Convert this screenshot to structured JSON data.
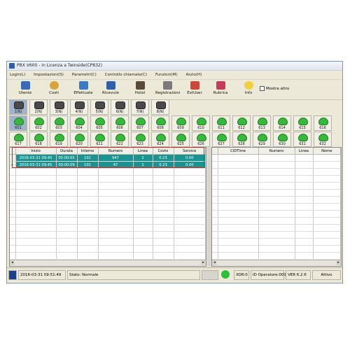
{
  "window": {
    "title": "PBX V600 - in Licenza a Twinside(CP832)"
  },
  "menu": [
    "Login(L)",
    "Impostazioni(S)",
    "Parametri(C)",
    "Controllo chiamate(C)",
    "Funzioni(M)",
    "Aiuto(H)"
  ],
  "toolbar": {
    "buttons": [
      {
        "label": "Utente",
        "icon": "user-icon"
      },
      {
        "label": "Costi",
        "icon": "coins-icon"
      },
      {
        "label": "Effettuate",
        "icon": "outgoing-call-icon"
      },
      {
        "label": "Ricevute",
        "icon": "incoming-call-icon"
      },
      {
        "label": "Hotel",
        "icon": "hotel-icon"
      },
      {
        "label": "Registrazioni",
        "icon": "recording-icon"
      },
      {
        "label": "ExtUser",
        "icon": "ext-user-icon"
      },
      {
        "label": "Rubrica",
        "icon": "phonebook-icon"
      },
      {
        "label": "Info",
        "icon": "info-bulb-icon"
      }
    ],
    "checkbox_label": "Mostra altro"
  },
  "lines": [
    "1(N)",
    "2(N)",
    "3(N)",
    "4(N)",
    "5(N)",
    "6(N)",
    "7(N)",
    "8(N)"
  ],
  "extensions_row1": [
    "601",
    "602",
    "603",
    "604",
    "605",
    "606",
    "607",
    "608",
    "609",
    "610",
    "611",
    "612",
    "613",
    "614",
    "615",
    "616"
  ],
  "extensions_row2": [
    "617",
    "618",
    "619",
    "620",
    "621",
    "622",
    "623",
    "624",
    "625",
    "626",
    "627",
    "628",
    "629",
    "630",
    "631",
    "632"
  ],
  "calls_table": {
    "columns": [
      "Inizio",
      "Durata",
      "Interno",
      "Numero",
      "Linea",
      "Costo",
      "Service"
    ],
    "rows": [
      [
        "2016-03-31 09:45",
        "00:00:05",
        "101",
        "947",
        "1",
        "0.23",
        "0.00"
      ],
      [
        "2016-03-31 09:45",
        "00:00:09",
        "101",
        "47",
        "1",
        "0.23",
        "0.00"
      ]
    ]
  },
  "cid_table": {
    "columns": [
      "CIDTime",
      "Numero",
      "Linea",
      "Nome"
    ]
  },
  "status": {
    "datetime": "2016-03-31 09:51:49",
    "state": "Stato: Normale",
    "xor": "XOR:0",
    "operator": "ID Operatore:001",
    "version": "VER 6.2.6",
    "active": "Attivo"
  },
  "colors": {
    "highlight_row": "#1a9490",
    "phone_active": "#36b83a",
    "selection_box": "#e02020"
  }
}
